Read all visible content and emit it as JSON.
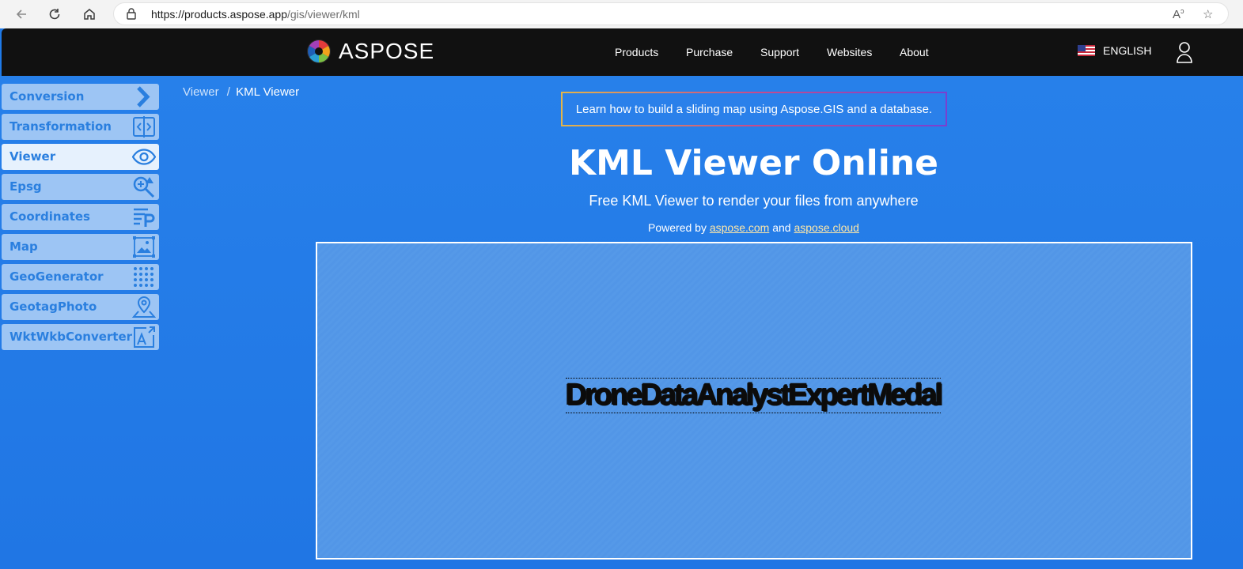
{
  "browser": {
    "url_host": "https://products.aspose.app",
    "url_path": "/gis/viewer/kml"
  },
  "header": {
    "brand": "ASPOSE",
    "nav": [
      "Products",
      "Purchase",
      "Support",
      "Websites",
      "About"
    ],
    "language": "ENGLISH"
  },
  "sidebar": {
    "items": [
      {
        "label": "Conversion",
        "icon": "chevron-right-icon"
      },
      {
        "label": "Transformation",
        "icon": "split-panel-icon"
      },
      {
        "label": "Viewer",
        "icon": "eye-icon",
        "active": true
      },
      {
        "label": "Epsg",
        "icon": "zoom-magnifier-icon"
      },
      {
        "label": "Coordinates",
        "icon": "list-p-icon"
      },
      {
        "label": "Map",
        "icon": "map-image-icon"
      },
      {
        "label": "GeoGenerator",
        "icon": "dot-grid-icon"
      },
      {
        "label": "GeotagPhoto",
        "icon": "map-pin-icon"
      },
      {
        "label": "WktWkbConverter",
        "icon": "text-convert-icon"
      }
    ]
  },
  "breadcrumb": {
    "parent": "Viewer",
    "separator": "/",
    "current": "KML Viewer"
  },
  "promo": "Learn how to build a sliding map using Aspose.GIS and a database.",
  "hero": {
    "title": "KML Viewer Online",
    "subtitle": "Free KML Viewer to render your files from anywhere",
    "powered_prefix": "Powered by",
    "link1": "aspose.com",
    "conjunction": "and",
    "link2": "aspose.cloud"
  },
  "viewer": {
    "map_text": "DroneDataAnalystExpertMedal"
  },
  "colors": {
    "page_bg": "#1f7ae8",
    "header_bg": "#111111",
    "sidebar_item": "#9dc5f4",
    "sidebar_active": "#e6f1fd",
    "sidebar_text": "#2a7fdf",
    "link": "#fde7a8"
  }
}
